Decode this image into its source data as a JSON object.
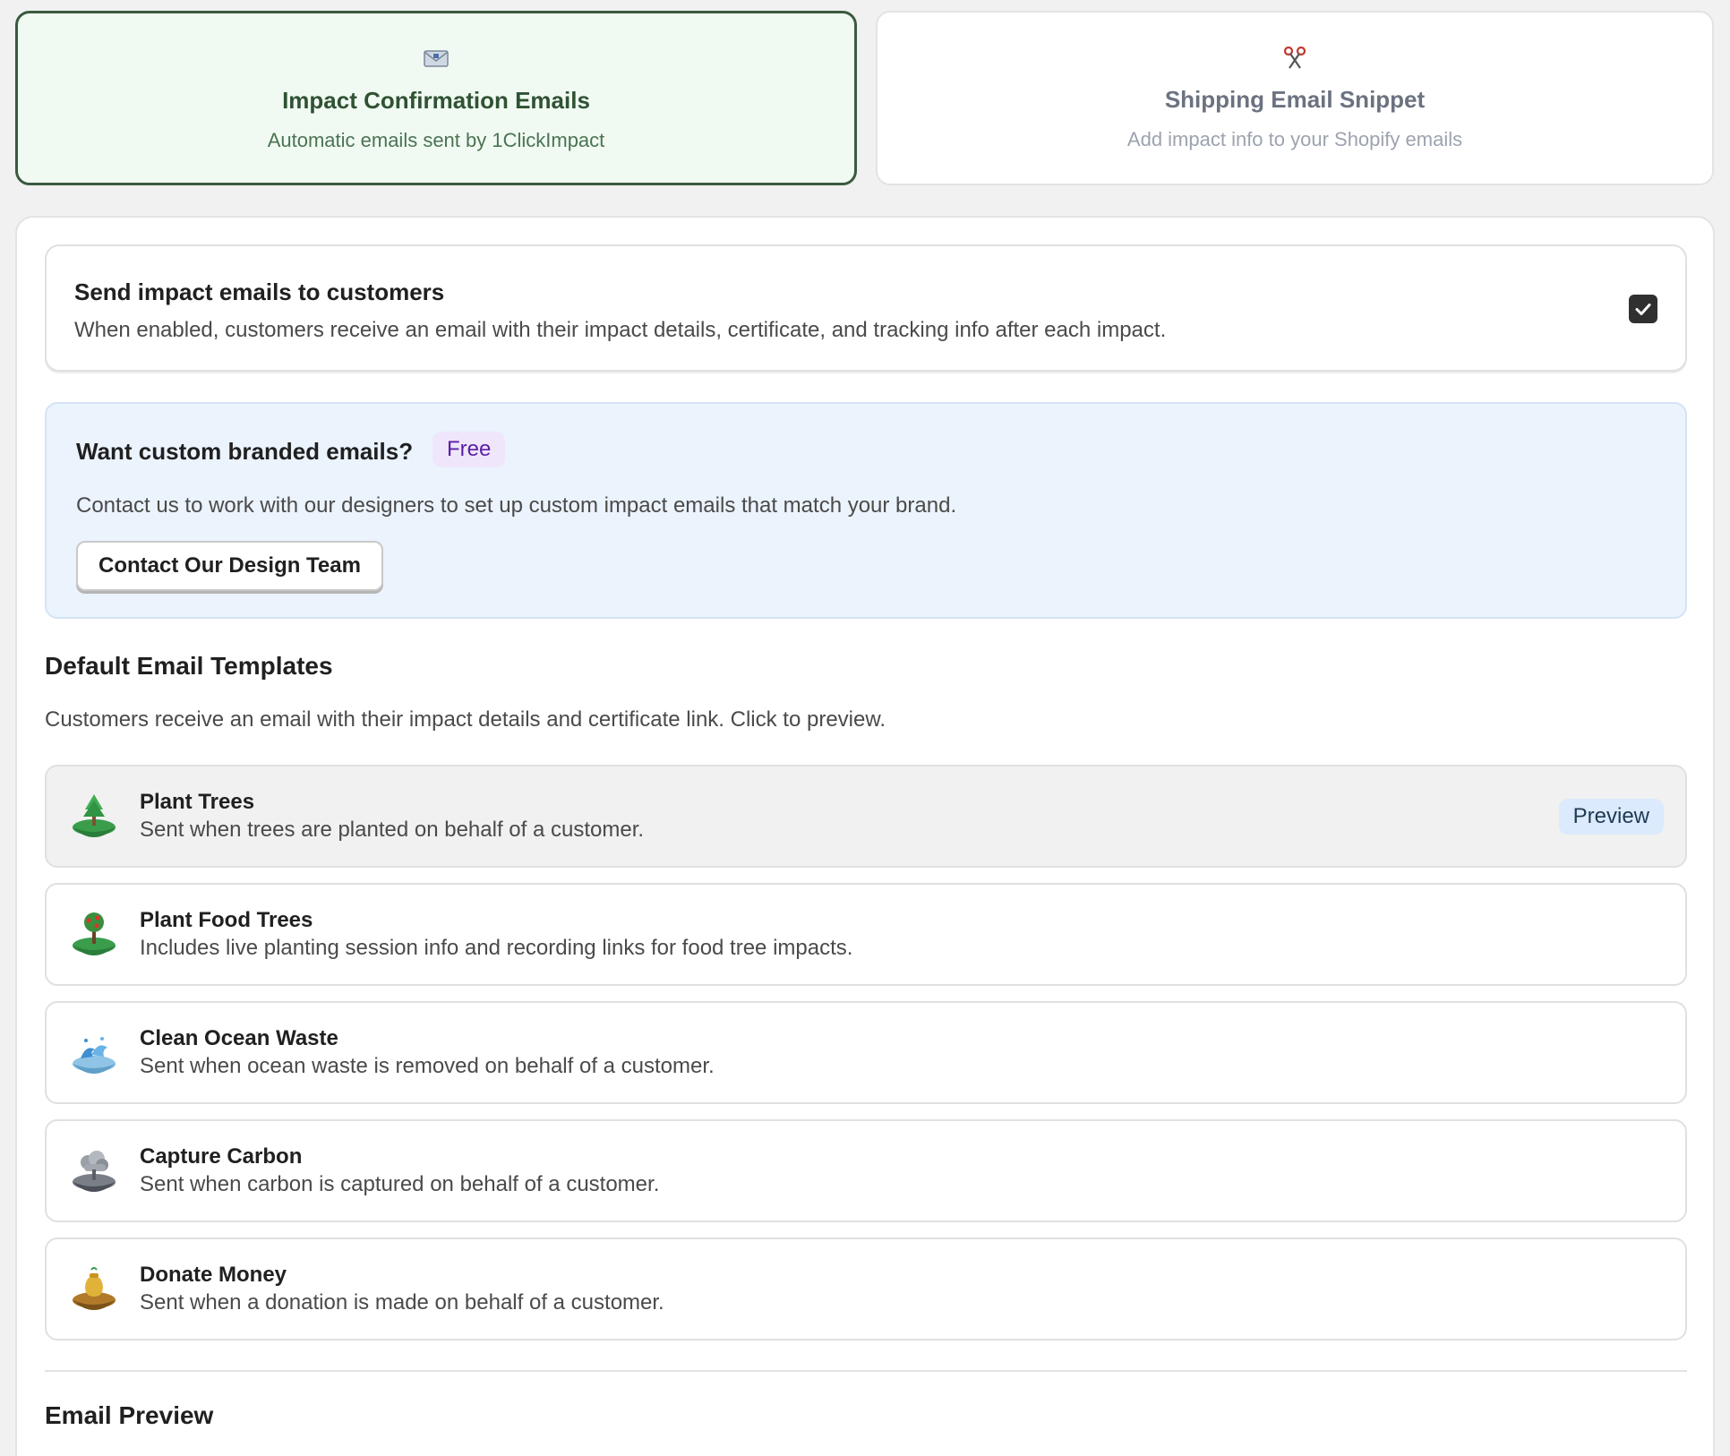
{
  "tabs": [
    {
      "title": "Impact Confirmation Emails",
      "subtitle": "Automatic emails sent by 1ClickImpact",
      "icon": "envelope-icon",
      "active": true
    },
    {
      "title": "Shipping Email Snippet",
      "subtitle": "Add impact info to your Shopify emails",
      "icon": "scissors-icon",
      "active": false
    }
  ],
  "toggle": {
    "title": "Send impact emails to customers",
    "description": "When enabled, customers receive an email with their impact details, certificate, and tracking info after each impact.",
    "checked": true
  },
  "promo": {
    "title": "Want custom branded emails?",
    "badge": "Free",
    "description": "Contact us to work with our designers to set up custom impact emails that match your brand.",
    "button_label": "Contact Our Design Team"
  },
  "templates_section": {
    "title": "Default Email Templates",
    "description": "Customers receive an email with their impact details and certificate link. Click to preview.",
    "preview_label": "Preview",
    "items": [
      {
        "title": "Plant Trees",
        "description": "Sent when trees are planted on behalf of a customer.",
        "icon": "plant-trees-icon",
        "selected": true
      },
      {
        "title": "Plant Food Trees",
        "description": "Includes live planting session info and recording links for food tree impacts.",
        "icon": "food-tree-icon",
        "selected": false
      },
      {
        "title": "Clean Ocean Waste",
        "description": "Sent when ocean waste is removed on behalf of a customer.",
        "icon": "ocean-wave-icon",
        "selected": false
      },
      {
        "title": "Capture Carbon",
        "description": "Sent when carbon is captured on behalf of a customer.",
        "icon": "carbon-cloud-icon",
        "selected": false
      },
      {
        "title": "Donate Money",
        "description": "Sent when a donation is made on behalf of a customer.",
        "icon": "money-bag-icon",
        "selected": false
      }
    ]
  },
  "preview_section": {
    "title": "Email Preview"
  },
  "colors": {
    "active_tab_border": "#3a5a40",
    "active_tab_bg": "#f0faf2",
    "promo_bg": "#ebf3fd",
    "free_badge_text": "#5b1fa6",
    "preview_badge_bg": "#dbeafc"
  }
}
